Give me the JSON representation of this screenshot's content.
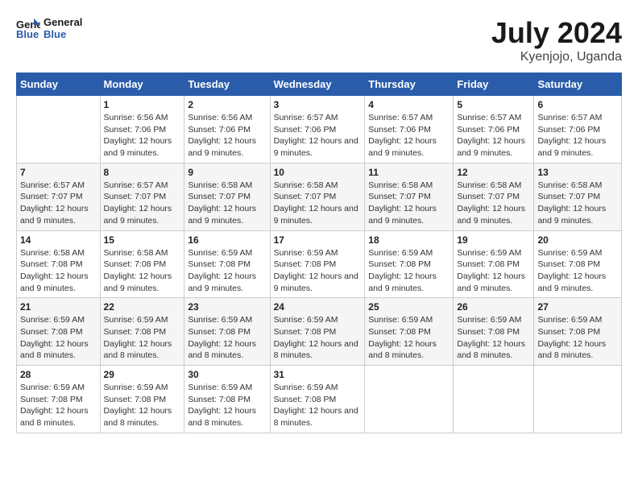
{
  "logo": {
    "line1": "General",
    "line2": "Blue"
  },
  "title": "July 2024",
  "subtitle": "Kyenjojo, Uganda",
  "days_of_week": [
    "Sunday",
    "Monday",
    "Tuesday",
    "Wednesday",
    "Thursday",
    "Friday",
    "Saturday"
  ],
  "weeks": [
    [
      {
        "num": "",
        "sunrise": "",
        "sunset": "",
        "daylight": ""
      },
      {
        "num": "1",
        "sunrise": "Sunrise: 6:56 AM",
        "sunset": "Sunset: 7:06 PM",
        "daylight": "Daylight: 12 hours and 9 minutes."
      },
      {
        "num": "2",
        "sunrise": "Sunrise: 6:56 AM",
        "sunset": "Sunset: 7:06 PM",
        "daylight": "Daylight: 12 hours and 9 minutes."
      },
      {
        "num": "3",
        "sunrise": "Sunrise: 6:57 AM",
        "sunset": "Sunset: 7:06 PM",
        "daylight": "Daylight: 12 hours and 9 minutes."
      },
      {
        "num": "4",
        "sunrise": "Sunrise: 6:57 AM",
        "sunset": "Sunset: 7:06 PM",
        "daylight": "Daylight: 12 hours and 9 minutes."
      },
      {
        "num": "5",
        "sunrise": "Sunrise: 6:57 AM",
        "sunset": "Sunset: 7:06 PM",
        "daylight": "Daylight: 12 hours and 9 minutes."
      },
      {
        "num": "6",
        "sunrise": "Sunrise: 6:57 AM",
        "sunset": "Sunset: 7:06 PM",
        "daylight": "Daylight: 12 hours and 9 minutes."
      }
    ],
    [
      {
        "num": "7",
        "sunrise": "Sunrise: 6:57 AM",
        "sunset": "Sunset: 7:07 PM",
        "daylight": "Daylight: 12 hours and 9 minutes."
      },
      {
        "num": "8",
        "sunrise": "Sunrise: 6:57 AM",
        "sunset": "Sunset: 7:07 PM",
        "daylight": "Daylight: 12 hours and 9 minutes."
      },
      {
        "num": "9",
        "sunrise": "Sunrise: 6:58 AM",
        "sunset": "Sunset: 7:07 PM",
        "daylight": "Daylight: 12 hours and 9 minutes."
      },
      {
        "num": "10",
        "sunrise": "Sunrise: 6:58 AM",
        "sunset": "Sunset: 7:07 PM",
        "daylight": "Daylight: 12 hours and 9 minutes."
      },
      {
        "num": "11",
        "sunrise": "Sunrise: 6:58 AM",
        "sunset": "Sunset: 7:07 PM",
        "daylight": "Daylight: 12 hours and 9 minutes."
      },
      {
        "num": "12",
        "sunrise": "Sunrise: 6:58 AM",
        "sunset": "Sunset: 7:07 PM",
        "daylight": "Daylight: 12 hours and 9 minutes."
      },
      {
        "num": "13",
        "sunrise": "Sunrise: 6:58 AM",
        "sunset": "Sunset: 7:07 PM",
        "daylight": "Daylight: 12 hours and 9 minutes."
      }
    ],
    [
      {
        "num": "14",
        "sunrise": "Sunrise: 6:58 AM",
        "sunset": "Sunset: 7:08 PM",
        "daylight": "Daylight: 12 hours and 9 minutes."
      },
      {
        "num": "15",
        "sunrise": "Sunrise: 6:58 AM",
        "sunset": "Sunset: 7:08 PM",
        "daylight": "Daylight: 12 hours and 9 minutes."
      },
      {
        "num": "16",
        "sunrise": "Sunrise: 6:59 AM",
        "sunset": "Sunset: 7:08 PM",
        "daylight": "Daylight: 12 hours and 9 minutes."
      },
      {
        "num": "17",
        "sunrise": "Sunrise: 6:59 AM",
        "sunset": "Sunset: 7:08 PM",
        "daylight": "Daylight: 12 hours and 9 minutes."
      },
      {
        "num": "18",
        "sunrise": "Sunrise: 6:59 AM",
        "sunset": "Sunset: 7:08 PM",
        "daylight": "Daylight: 12 hours and 9 minutes."
      },
      {
        "num": "19",
        "sunrise": "Sunrise: 6:59 AM",
        "sunset": "Sunset: 7:08 PM",
        "daylight": "Daylight: 12 hours and 9 minutes."
      },
      {
        "num": "20",
        "sunrise": "Sunrise: 6:59 AM",
        "sunset": "Sunset: 7:08 PM",
        "daylight": "Daylight: 12 hours and 9 minutes."
      }
    ],
    [
      {
        "num": "21",
        "sunrise": "Sunrise: 6:59 AM",
        "sunset": "Sunset: 7:08 PM",
        "daylight": "Daylight: 12 hours and 8 minutes."
      },
      {
        "num": "22",
        "sunrise": "Sunrise: 6:59 AM",
        "sunset": "Sunset: 7:08 PM",
        "daylight": "Daylight: 12 hours and 8 minutes."
      },
      {
        "num": "23",
        "sunrise": "Sunrise: 6:59 AM",
        "sunset": "Sunset: 7:08 PM",
        "daylight": "Daylight: 12 hours and 8 minutes."
      },
      {
        "num": "24",
        "sunrise": "Sunrise: 6:59 AM",
        "sunset": "Sunset: 7:08 PM",
        "daylight": "Daylight: 12 hours and 8 minutes."
      },
      {
        "num": "25",
        "sunrise": "Sunrise: 6:59 AM",
        "sunset": "Sunset: 7:08 PM",
        "daylight": "Daylight: 12 hours and 8 minutes."
      },
      {
        "num": "26",
        "sunrise": "Sunrise: 6:59 AM",
        "sunset": "Sunset: 7:08 PM",
        "daylight": "Daylight: 12 hours and 8 minutes."
      },
      {
        "num": "27",
        "sunrise": "Sunrise: 6:59 AM",
        "sunset": "Sunset: 7:08 PM",
        "daylight": "Daylight: 12 hours and 8 minutes."
      }
    ],
    [
      {
        "num": "28",
        "sunrise": "Sunrise: 6:59 AM",
        "sunset": "Sunset: 7:08 PM",
        "daylight": "Daylight: 12 hours and 8 minutes."
      },
      {
        "num": "29",
        "sunrise": "Sunrise: 6:59 AM",
        "sunset": "Sunset: 7:08 PM",
        "daylight": "Daylight: 12 hours and 8 minutes."
      },
      {
        "num": "30",
        "sunrise": "Sunrise: 6:59 AM",
        "sunset": "Sunset: 7:08 PM",
        "daylight": "Daylight: 12 hours and 8 minutes."
      },
      {
        "num": "31",
        "sunrise": "Sunrise: 6:59 AM",
        "sunset": "Sunset: 7:08 PM",
        "daylight": "Daylight: 12 hours and 8 minutes."
      },
      {
        "num": "",
        "sunrise": "",
        "sunset": "",
        "daylight": ""
      },
      {
        "num": "",
        "sunrise": "",
        "sunset": "",
        "daylight": ""
      },
      {
        "num": "",
        "sunrise": "",
        "sunset": "",
        "daylight": ""
      }
    ]
  ]
}
